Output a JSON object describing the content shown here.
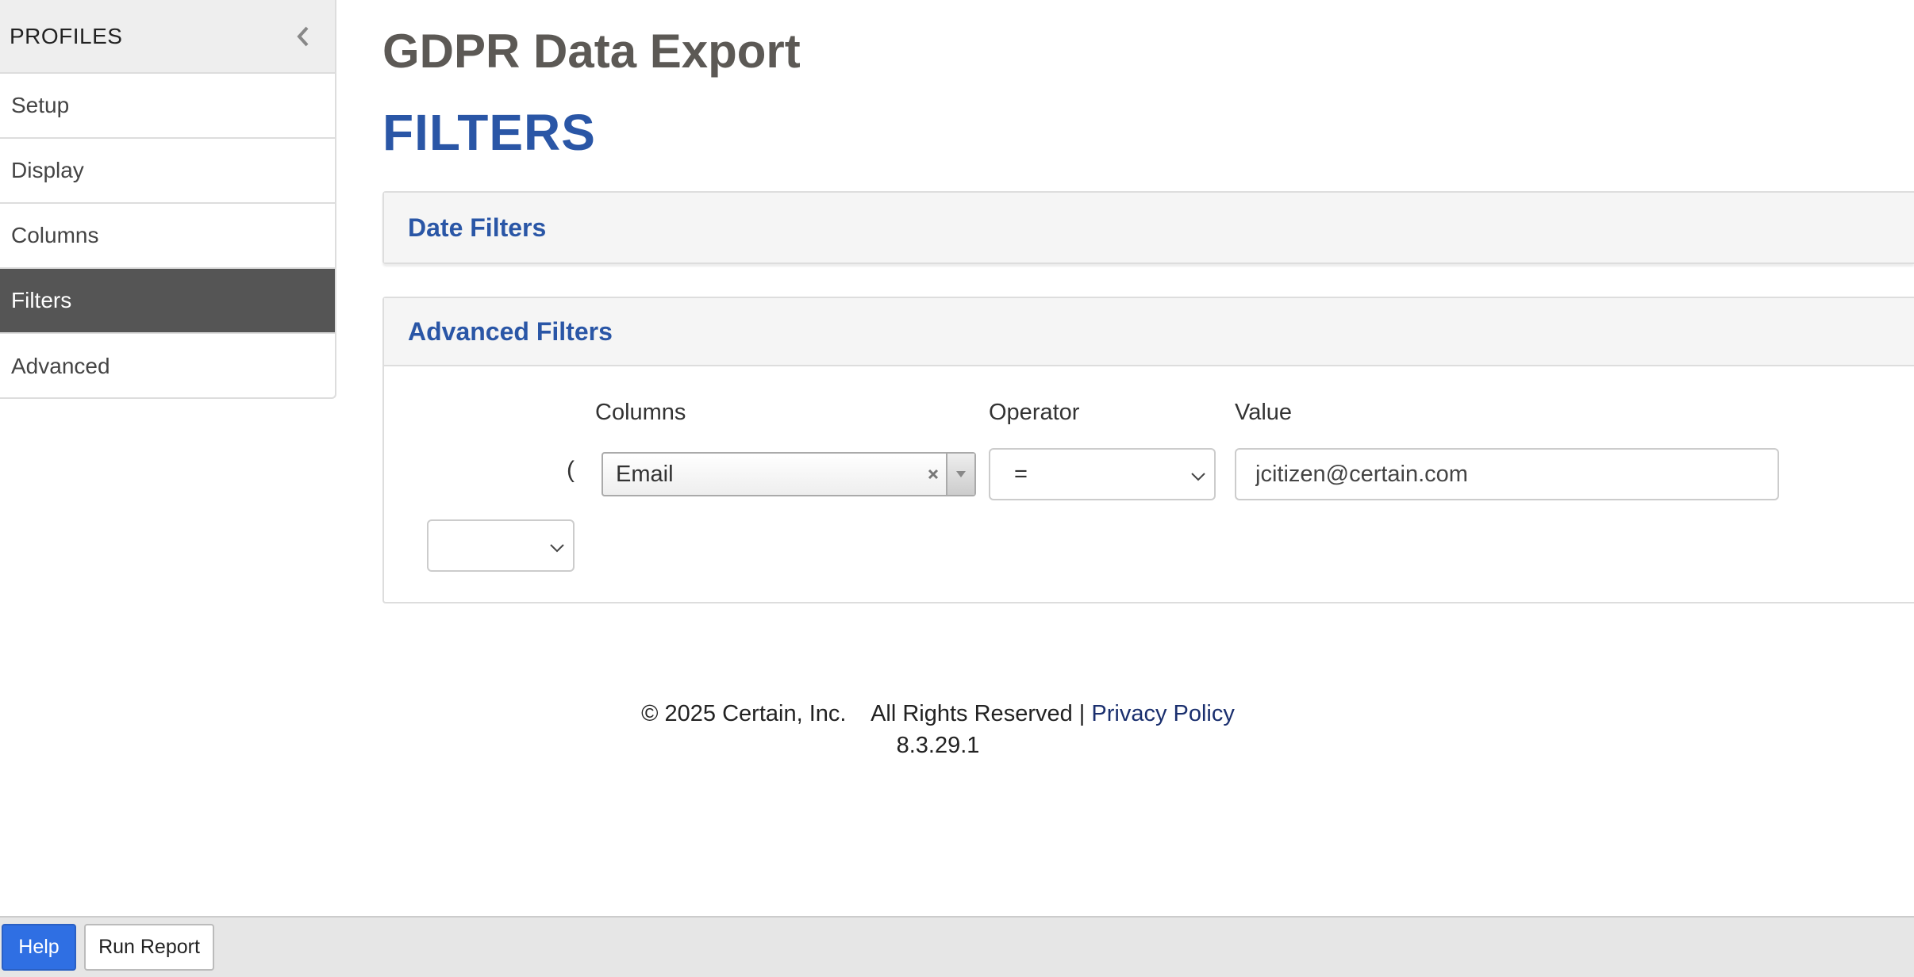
{
  "sidebar": {
    "title": "PROFILES",
    "items": [
      {
        "label": "Setup"
      },
      {
        "label": "Display"
      },
      {
        "label": "Columns"
      },
      {
        "label": "Filters"
      },
      {
        "label": "Advanced"
      }
    ],
    "active_item": "Filters"
  },
  "main": {
    "page_title": "GDPR Data Export",
    "section_title": "FILTERS",
    "date_filters": {
      "heading": "Date Filters"
    },
    "advanced_filters": {
      "heading": "Advanced Filters",
      "columns_label": "Columns",
      "operator_label": "Operator",
      "value_label": "Value",
      "open_paren": "(",
      "column_value": "Email",
      "operator_value": "=",
      "value_input": "jcitizen@certain.com",
      "conjunction_value": ""
    }
  },
  "footer": {
    "copyright": "© 2025 Certain, Inc.    All Rights Reserved |",
    "privacy_link": "Privacy Policy",
    "version": "8.3.29.1"
  },
  "toolbar": {
    "help_label": "Help",
    "run_report_label": "Run Report"
  },
  "colors": {
    "accent_blue": "#2a56a6",
    "help_button": "#2f6fe3",
    "active_sidebar": "#555555"
  }
}
